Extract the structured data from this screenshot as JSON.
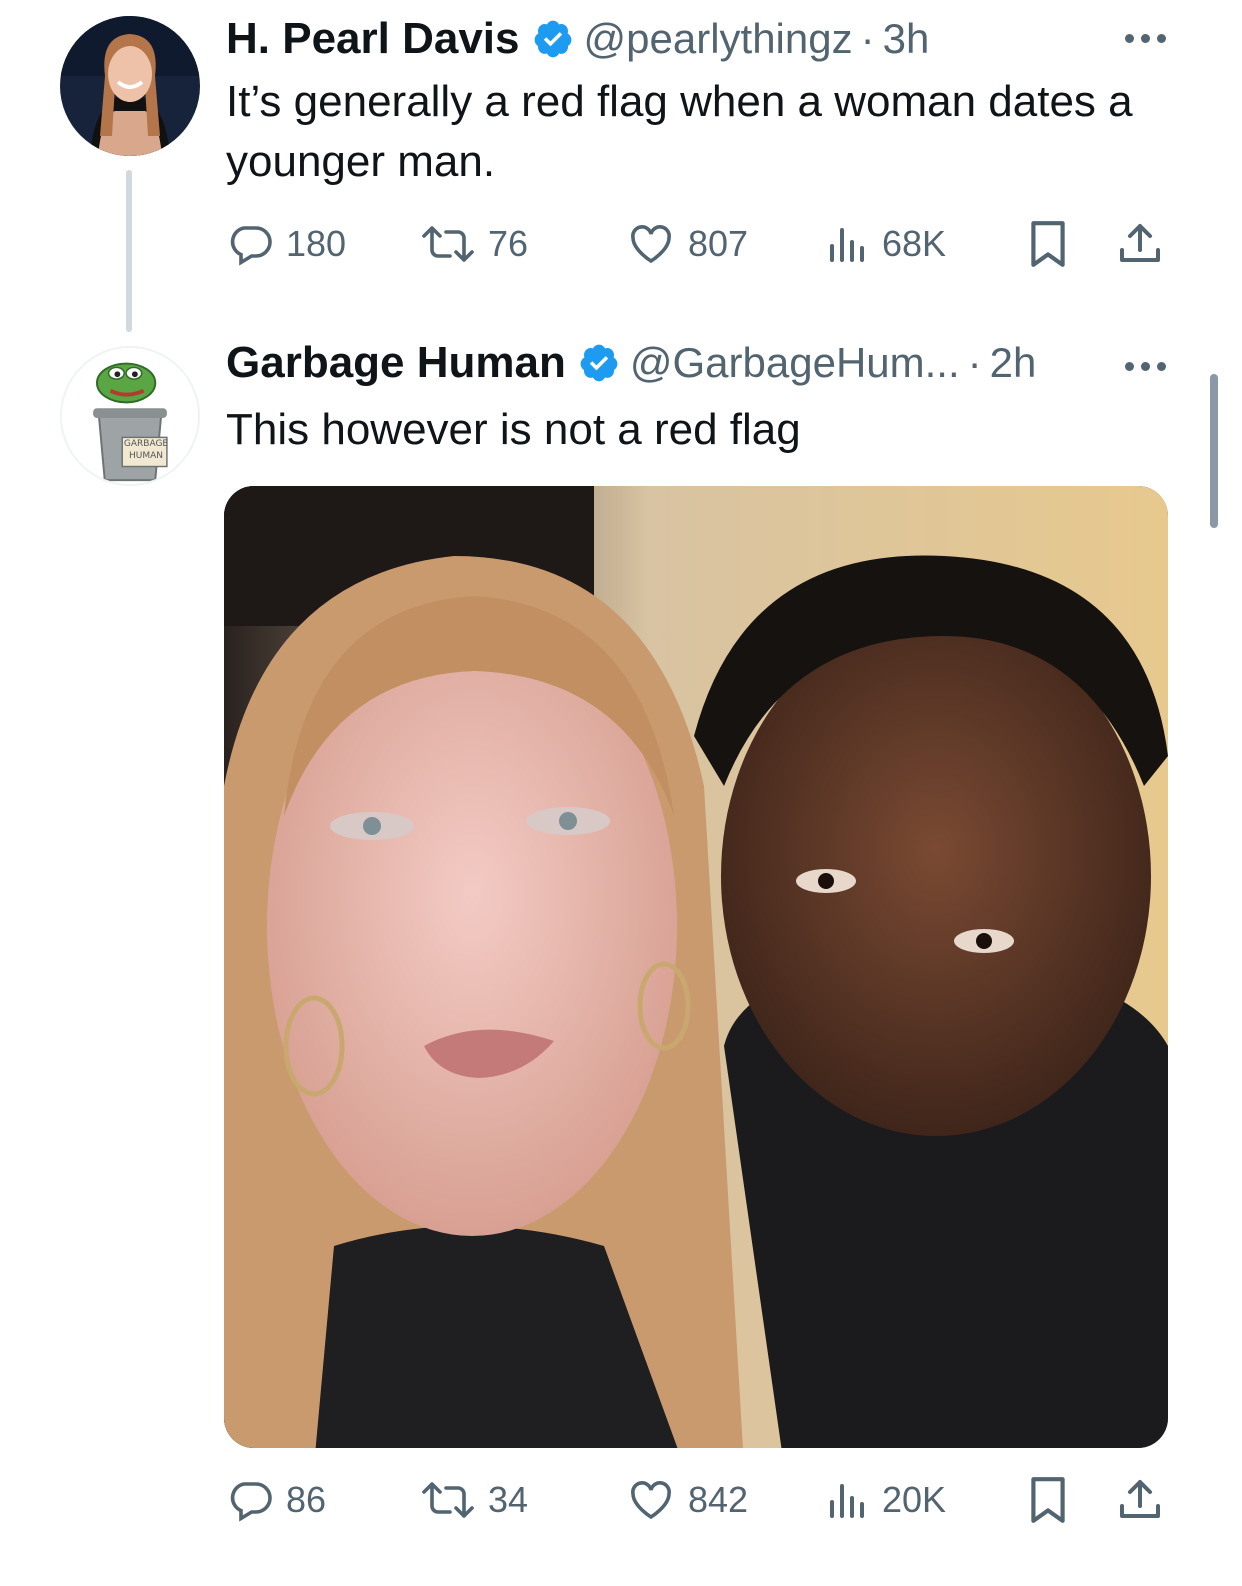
{
  "tweets": [
    {
      "name": "H. Pearl Davis",
      "handle": "@pearlythingz",
      "separator": "·",
      "time": "3h",
      "text": "It’s generally a red flag when a woman dates a younger man.",
      "replies": "180",
      "retweets": "76",
      "likes": "807",
      "views": "68K"
    },
    {
      "name": "Garbage Human",
      "handle": "@GarbageHum...",
      "separator": "·",
      "time": "2h",
      "text": "This however is not a red flag",
      "avatar_sign": "GARBAGE HUMAN",
      "replies": "86",
      "retweets": "34",
      "likes": "842",
      "views": "20K"
    }
  ],
  "icons": [
    "verified-badge-icon",
    "more-icon",
    "reply-icon",
    "retweet-icon",
    "like-icon",
    "views-icon",
    "bookmark-icon",
    "share-icon"
  ],
  "colors": {
    "text": "#0f1419",
    "secondary": "#536471",
    "verified": "#1d9bf0",
    "thread_line": "#cfd9de"
  }
}
